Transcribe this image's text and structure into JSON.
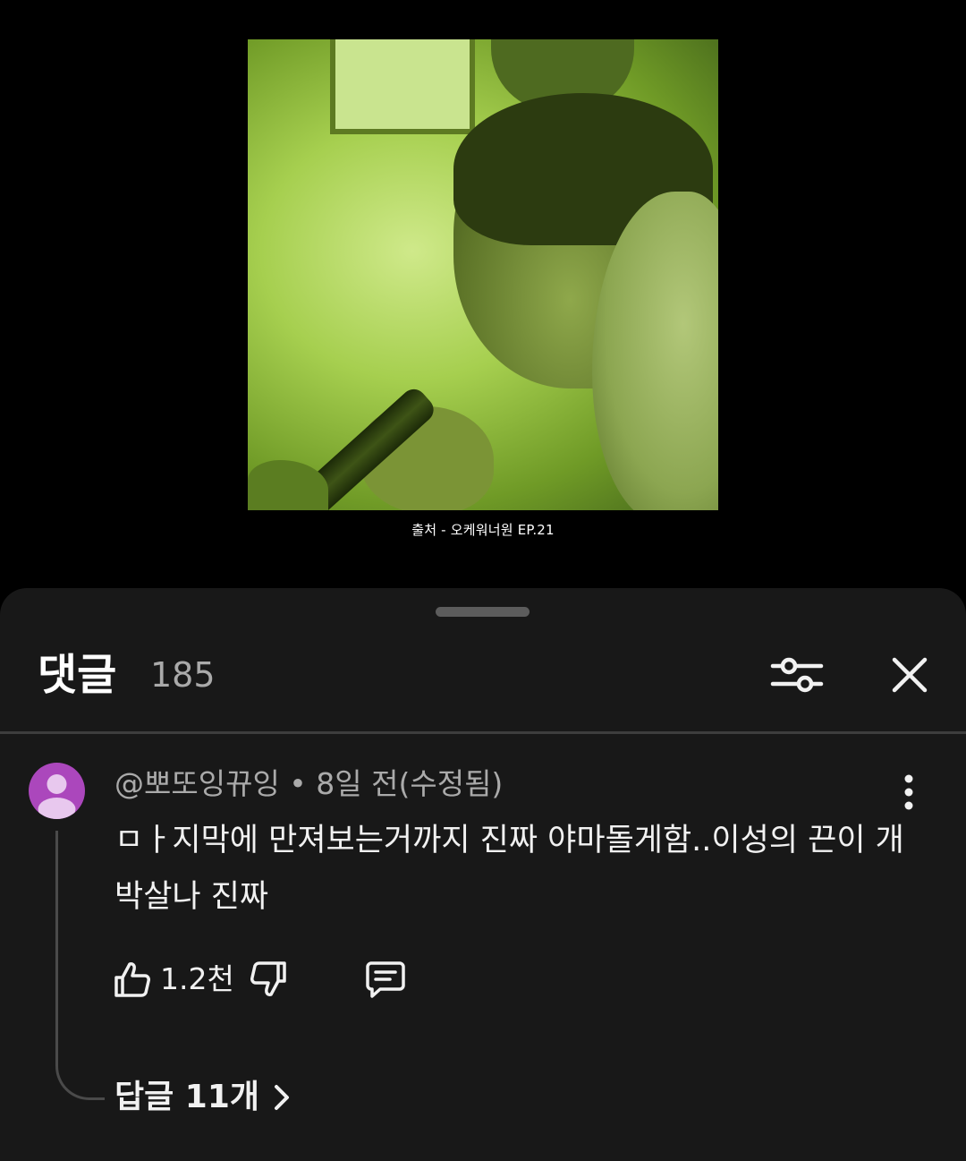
{
  "video": {
    "caption": "출처 - 오케워너원 EP.21"
  },
  "comments_panel": {
    "title": "댓글",
    "count": "185",
    "filter_icon": "sliders-icon",
    "close_icon": "close-icon"
  },
  "comment": {
    "author": "@뽀또잉뀨잉",
    "separator": " • ",
    "time": "8일 전(수정됨)",
    "text": "ㅁㅏ지막에 만져보는거까지 진짜 야마돌게함..이성의 끈이 개박살나 진짜",
    "likes": "1.2천",
    "replies_label": "답글 11개",
    "avatar_color": "#ab47bc"
  },
  "colors": {
    "sheet_bg": "#181818",
    "primary_text": "#f1f1f1",
    "secondary_text": "#aaaaaa"
  }
}
